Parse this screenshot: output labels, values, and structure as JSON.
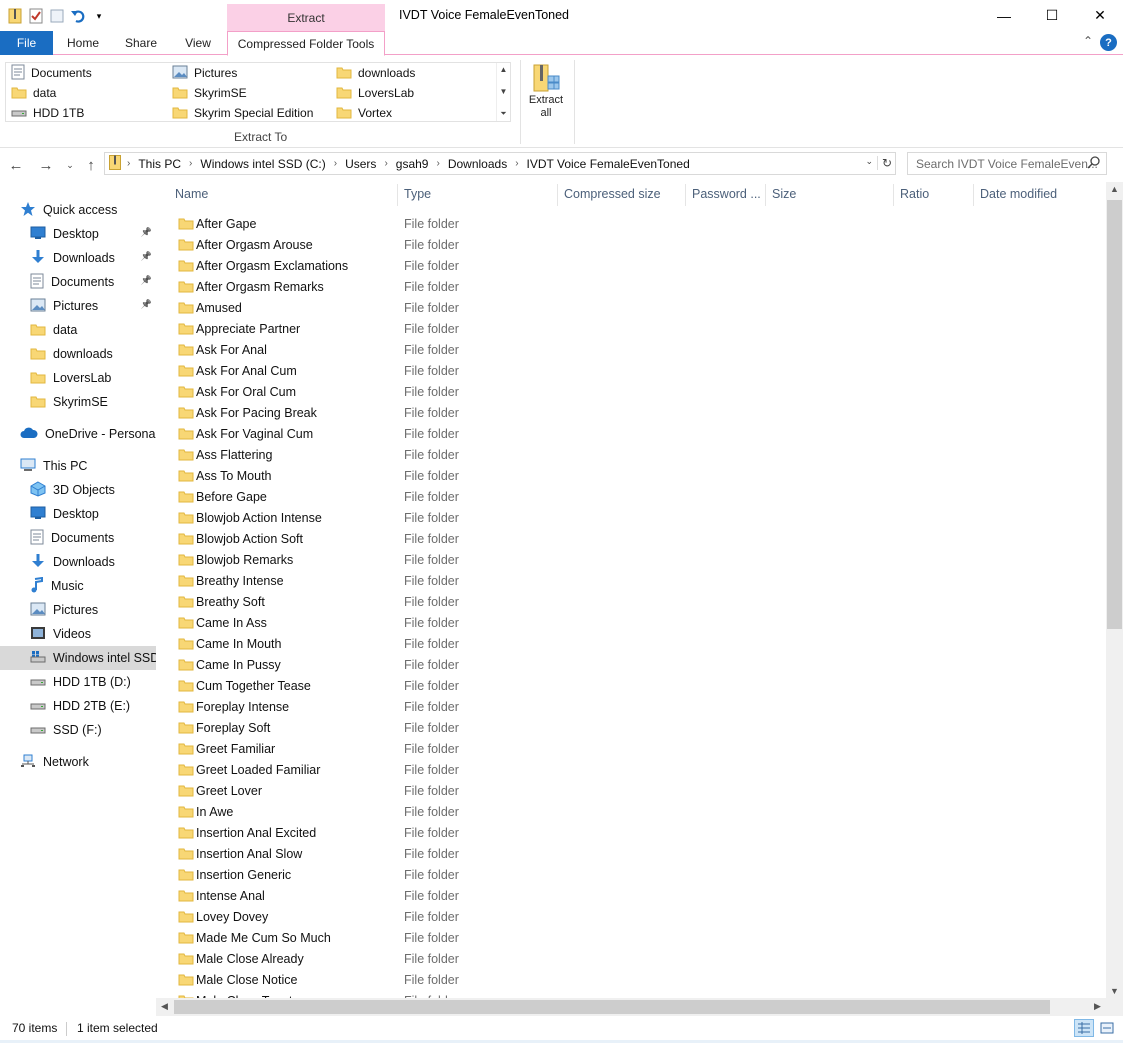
{
  "colors": {
    "accent": "#1a6dc2",
    "context_tab": "#fbd0e6",
    "folder": "#f8d775",
    "folder_dark": "#e2b73f"
  },
  "title_bar": {
    "context_tab_label": "Extract",
    "window_title": "IVDT Voice FemaleEvenToned",
    "minimize": "—",
    "maximize": "☐",
    "close": "✕"
  },
  "ribbon_tabs": {
    "file": "File",
    "home": "Home",
    "share": "Share",
    "view": "View",
    "compressed": "Compressed Folder Tools",
    "help": "?"
  },
  "ribbon": {
    "destinations": [
      {
        "label": "Documents",
        "icon": "documents-icon"
      },
      {
        "label": "data",
        "icon": "folder-icon"
      },
      {
        "label": "HDD 1TB",
        "icon": "drive-icon"
      },
      {
        "label": "Pictures",
        "icon": "pictures-icon"
      },
      {
        "label": "SkyrimSE",
        "icon": "folder-icon"
      },
      {
        "label": "Skyrim Special Edition",
        "icon": "folder-icon"
      },
      {
        "label": "downloads",
        "icon": "folder-icon"
      },
      {
        "label": "LoversLab",
        "icon": "folder-icon"
      },
      {
        "label": "Vortex",
        "icon": "folder-icon"
      }
    ],
    "group_label": "Extract To",
    "extract_all_line1": "Extract",
    "extract_all_line2": "all"
  },
  "address": {
    "crumbs": [
      "This PC",
      "Windows intel SSD (C:)",
      "Users",
      "gsah9",
      "Downloads",
      "IVDT Voice FemaleEvenToned"
    ],
    "search_placeholder": "Search IVDT Voice FemaleEven..."
  },
  "nav_pane": {
    "items": [
      {
        "label": "Quick access",
        "icon": "star-icon",
        "indent": 0,
        "pinned": false
      },
      {
        "label": "Desktop",
        "icon": "desktop-icon",
        "indent": 1,
        "pinned": true
      },
      {
        "label": "Downloads",
        "icon": "download-icon",
        "indent": 1,
        "pinned": true
      },
      {
        "label": "Documents",
        "icon": "documents-icon",
        "indent": 1,
        "pinned": true
      },
      {
        "label": "Pictures",
        "icon": "pictures-icon",
        "indent": 1,
        "pinned": true
      },
      {
        "label": "data",
        "icon": "folder-icon",
        "indent": 1,
        "pinned": false
      },
      {
        "label": "downloads",
        "icon": "folder-icon",
        "indent": 1,
        "pinned": false
      },
      {
        "label": "LoversLab",
        "icon": "folder-icon",
        "indent": 1,
        "pinned": false
      },
      {
        "label": "SkyrimSE",
        "icon": "folder-icon",
        "indent": 1,
        "pinned": false
      },
      {
        "label": "OneDrive - Personal",
        "icon": "cloud-icon",
        "indent": 0,
        "pinned": false
      },
      {
        "label": "This PC",
        "icon": "computer-icon",
        "indent": 0,
        "pinned": false
      },
      {
        "label": "3D Objects",
        "icon": "cube-icon",
        "indent": 1,
        "pinned": false
      },
      {
        "label": "Desktop",
        "icon": "desktop-icon",
        "indent": 1,
        "pinned": false
      },
      {
        "label": "Documents",
        "icon": "documents-icon",
        "indent": 1,
        "pinned": false
      },
      {
        "label": "Downloads",
        "icon": "download-icon",
        "indent": 1,
        "pinned": false
      },
      {
        "label": "Music",
        "icon": "music-icon",
        "indent": 1,
        "pinned": false
      },
      {
        "label": "Pictures",
        "icon": "pictures-icon",
        "indent": 1,
        "pinned": false
      },
      {
        "label": "Videos",
        "icon": "video-icon",
        "indent": 1,
        "pinned": false
      },
      {
        "label": "Windows intel SSD (",
        "icon": "windows-drive-icon",
        "indent": 1,
        "pinned": false,
        "selected": true
      },
      {
        "label": "HDD 1TB (D:)",
        "icon": "drive-icon",
        "indent": 1,
        "pinned": false
      },
      {
        "label": "HDD 2TB (E:)",
        "icon": "drive-icon",
        "indent": 1,
        "pinned": false
      },
      {
        "label": "SSD (F:)",
        "icon": "drive-icon",
        "indent": 1,
        "pinned": false
      },
      {
        "label": "Network",
        "icon": "network-icon",
        "indent": 0,
        "pinned": false
      }
    ]
  },
  "columns": [
    "Name",
    "Type",
    "Compressed size",
    "Password ...",
    "Size",
    "Ratio",
    "Date modified"
  ],
  "files": [
    {
      "name": "After Gape",
      "type": "File folder"
    },
    {
      "name": "After Orgasm Arouse",
      "type": "File folder"
    },
    {
      "name": "After Orgasm Exclamations",
      "type": "File folder"
    },
    {
      "name": "After Orgasm Remarks",
      "type": "File folder"
    },
    {
      "name": "Amused",
      "type": "File folder"
    },
    {
      "name": "Appreciate Partner",
      "type": "File folder"
    },
    {
      "name": "Ask For Anal",
      "type": "File folder"
    },
    {
      "name": "Ask For Anal Cum",
      "type": "File folder"
    },
    {
      "name": "Ask For Oral Cum",
      "type": "File folder"
    },
    {
      "name": "Ask For Pacing Break",
      "type": "File folder"
    },
    {
      "name": "Ask For Vaginal Cum",
      "type": "File folder"
    },
    {
      "name": "Ass Flattering",
      "type": "File folder"
    },
    {
      "name": "Ass To Mouth",
      "type": "File folder"
    },
    {
      "name": "Before Gape",
      "type": "File folder"
    },
    {
      "name": "Blowjob Action Intense",
      "type": "File folder"
    },
    {
      "name": "Blowjob Action Soft",
      "type": "File folder"
    },
    {
      "name": "Blowjob Remarks",
      "type": "File folder"
    },
    {
      "name": "Breathy Intense",
      "type": "File folder"
    },
    {
      "name": "Breathy Soft",
      "type": "File folder"
    },
    {
      "name": "Came In Ass",
      "type": "File folder"
    },
    {
      "name": "Came In Mouth",
      "type": "File folder"
    },
    {
      "name": "Came In Pussy",
      "type": "File folder"
    },
    {
      "name": "Cum Together Tease",
      "type": "File folder"
    },
    {
      "name": "Foreplay Intense",
      "type": "File folder"
    },
    {
      "name": "Foreplay Soft",
      "type": "File folder"
    },
    {
      "name": "Greet Familiar",
      "type": "File folder"
    },
    {
      "name": "Greet Loaded Familiar",
      "type": "File folder"
    },
    {
      "name": "Greet Lover",
      "type": "File folder"
    },
    {
      "name": "In Awe",
      "type": "File folder"
    },
    {
      "name": "Insertion Anal Excited",
      "type": "File folder"
    },
    {
      "name": "Insertion Anal Slow",
      "type": "File folder"
    },
    {
      "name": "Insertion Generic",
      "type": "File folder"
    },
    {
      "name": "Intense Anal",
      "type": "File folder"
    },
    {
      "name": "Lovey Dovey",
      "type": "File folder"
    },
    {
      "name": "Made Me Cum So Much",
      "type": "File folder"
    },
    {
      "name": "Male Close Already",
      "type": "File folder"
    },
    {
      "name": "Male Close Notice",
      "type": "File folder"
    },
    {
      "name": "Male Close Taunt",
      "type": "File folder"
    }
  ],
  "status": {
    "items_count": "70 items",
    "selected": "1 item selected"
  },
  "scroll": {
    "vertical_fraction": 0.0,
    "vertical_visible_fraction": 0.55
  }
}
